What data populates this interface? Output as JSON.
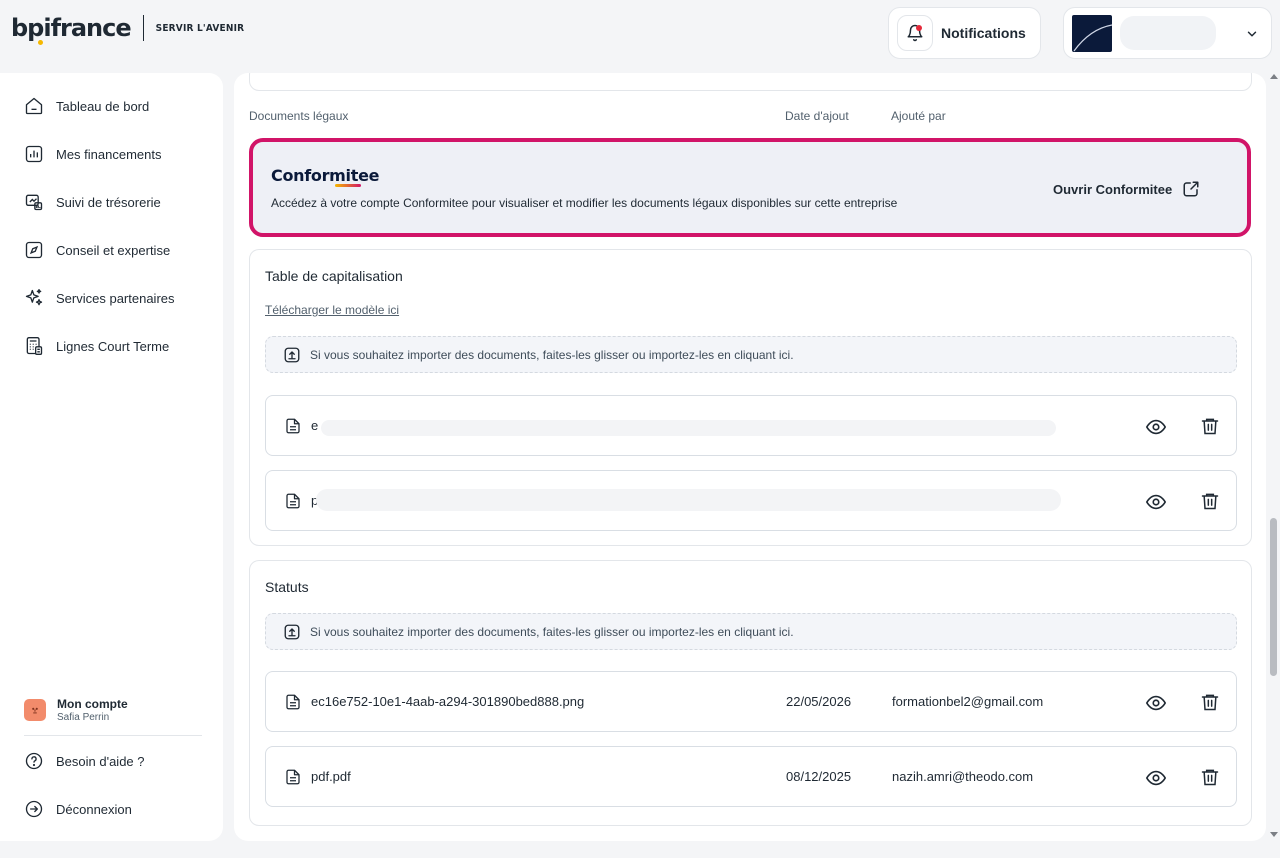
{
  "brand": {
    "logo_text": "bpifrance",
    "tagline": "SERVIR L'AVENIR"
  },
  "header": {
    "notifications_label": "Notifications",
    "colors": {
      "notif_dot": "#e5293a"
    }
  },
  "sidebar": {
    "items": [
      {
        "label": "Tableau de bord",
        "icon": "home-icon"
      },
      {
        "label": "Mes financements",
        "icon": "chart-icon"
      },
      {
        "label": "Suivi de trésorerie",
        "icon": "treasury-icon"
      },
      {
        "label": "Conseil et expertise",
        "icon": "compass-icon"
      },
      {
        "label": "Services partenaires",
        "icon": "sparkles-icon"
      },
      {
        "label": "Lignes Court Terme",
        "icon": "calculator-icon"
      }
    ],
    "account": {
      "title": "Mon compte",
      "user": "Safia Perrin"
    },
    "help_label": "Besoin d'aide ?",
    "logout_label": "Déconnexion"
  },
  "legal_docs": {
    "columns": [
      "Documents légaux",
      "Date d'ajout",
      "Ajouté par"
    ],
    "conformitee": {
      "brand": "Conformitee",
      "description": "Accédez à votre compte Conformitee pour visualiser et modifier les documents légaux disponibles sur cette entreprise",
      "open_label": "Ouvrir Conformitee",
      "highlight_color": "#d11468"
    }
  },
  "cap_table": {
    "title": "Table de capitalisation",
    "template_link": "Télécharger le modèle ici",
    "dropzone": "Si vous souhaitez importer des documents, faites-les glisser ou importez-les en cliquant ici.",
    "files": [
      {
        "name": "e"
      },
      {
        "name": "p"
      }
    ]
  },
  "statuts": {
    "title": "Statuts",
    "dropzone": "Si vous souhaitez importer des documents, faites-les glisser ou importez-les en cliquant ici.",
    "files": [
      {
        "name": "ec16e752-10e1-4aab-a294-301890bed888.png",
        "date": "22/05/2026",
        "by": "formationbel2@gmail.com"
      },
      {
        "name": "pdf.pdf",
        "date": "08/12/2025",
        "by": "nazih.amri@theodo.com"
      }
    ]
  }
}
